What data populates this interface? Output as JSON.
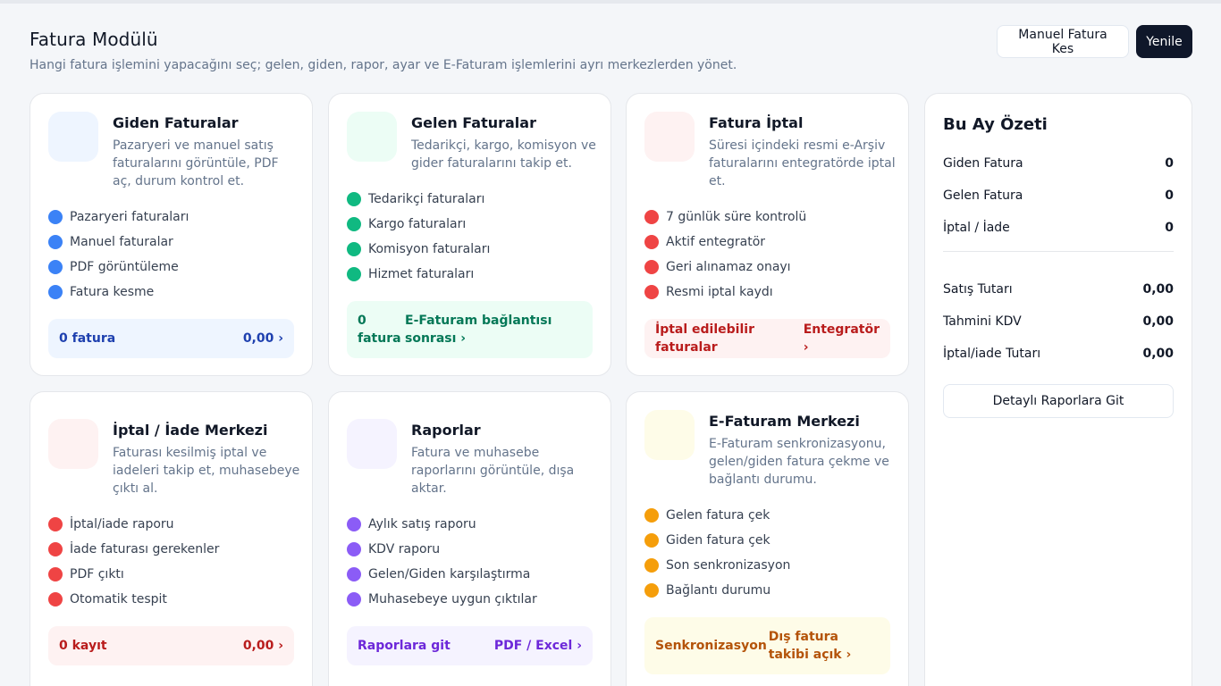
{
  "header": {
    "title": "Fatura Modülü",
    "subtitle": "Hangi fatura işlemini yapacağını seç; gelen, giden, rapor, ayar ve E-Faturam işlemlerini ayrı merkezlerden yönet.",
    "manual_button": "Manuel Fatura Kes",
    "refresh_button": "Yenile"
  },
  "cards": {
    "giden": {
      "title": "Giden Faturalar",
      "desc": "Pazaryeri ve manuel satış faturalarını görüntüle, PDF aç, durum kontrol et.",
      "items": [
        "Pazaryeri faturaları",
        "Manuel faturalar",
        "PDF görüntüleme",
        "Fatura kesme"
      ],
      "footer_left": "0 fatura",
      "footer_right": "0,00 ›"
    },
    "gelen": {
      "title": "Gelen Faturalar",
      "desc": "Tedarikçi, kargo, komisyon ve gider faturalarını takip et.",
      "items": [
        "Tedarikçi faturaları",
        "Kargo faturaları",
        "Komisyon faturaları",
        "Hizmet faturaları"
      ],
      "footer_left": "0 fatura",
      "footer_right": "E-Faturam bağlantısı sonrası ›"
    },
    "iptal": {
      "title": "Fatura İptal",
      "desc": "Süresi içindeki resmi e-Arşiv faturalarını entegratörde iptal et.",
      "items": [
        "7 günlük süre kontrolü",
        "Aktif entegratör",
        "Geri alınamaz onayı",
        "Resmi iptal kaydı"
      ],
      "footer_left": "İptal edilebilir faturalar",
      "footer_right": "Entegratör ›"
    },
    "iade": {
      "title": "İptal / İade Merkezi",
      "desc": "Faturası kesilmiş iptal ve iadeleri takip et, muhasebeye çıktı al.",
      "items": [
        "İptal/iade raporu",
        "İade faturası gerekenler",
        "PDF çıktı",
        "Otomatik tespit"
      ],
      "footer_left": "0 kayıt",
      "footer_right": "0,00 ›"
    },
    "raporlar": {
      "title": "Raporlar",
      "desc": "Fatura ve muhasebe raporlarını görüntüle, dışa aktar.",
      "items": [
        "Aylık satış raporu",
        "KDV raporu",
        "Gelen/Giden karşılaştırma",
        "Muhasebeye uygun çıktılar"
      ],
      "footer_left": "Raporlara git",
      "footer_right": "PDF / Excel ›"
    },
    "efaturam": {
      "title": "E-Faturam Merkezi",
      "desc": "E-Faturam senkronizasyonu, gelen/giden fatura çekme ve bağlantı durumu.",
      "items": [
        "Gelen fatura çek",
        "Giden fatura çek",
        "Son senkronizasyon",
        "Bağlantı durumu"
      ],
      "footer_left": "Senkronizasyon",
      "footer_right": "Dış fatura takibi açık ›"
    }
  },
  "summary": {
    "title": "Bu Ay Özeti",
    "rows": [
      {
        "label": "Giden Fatura",
        "value": "0"
      },
      {
        "label": "Gelen Fatura",
        "value": "0"
      },
      {
        "label": "İptal / İade",
        "value": "0"
      },
      {
        "label": "Satış Tutarı",
        "value": "0,00"
      },
      {
        "label": "Tahmini KDV",
        "value": "0,00"
      },
      {
        "label": "İptal/iade Tutarı",
        "value": "0,00"
      }
    ],
    "button": "Detaylı Raporlara Git"
  },
  "colors": {
    "blue": "#3b82f6",
    "green": "#10b981",
    "red": "#ef4444",
    "purple": "#8b5cf6",
    "yellow": "#f59e0b",
    "dark_button": "#0f172a"
  }
}
